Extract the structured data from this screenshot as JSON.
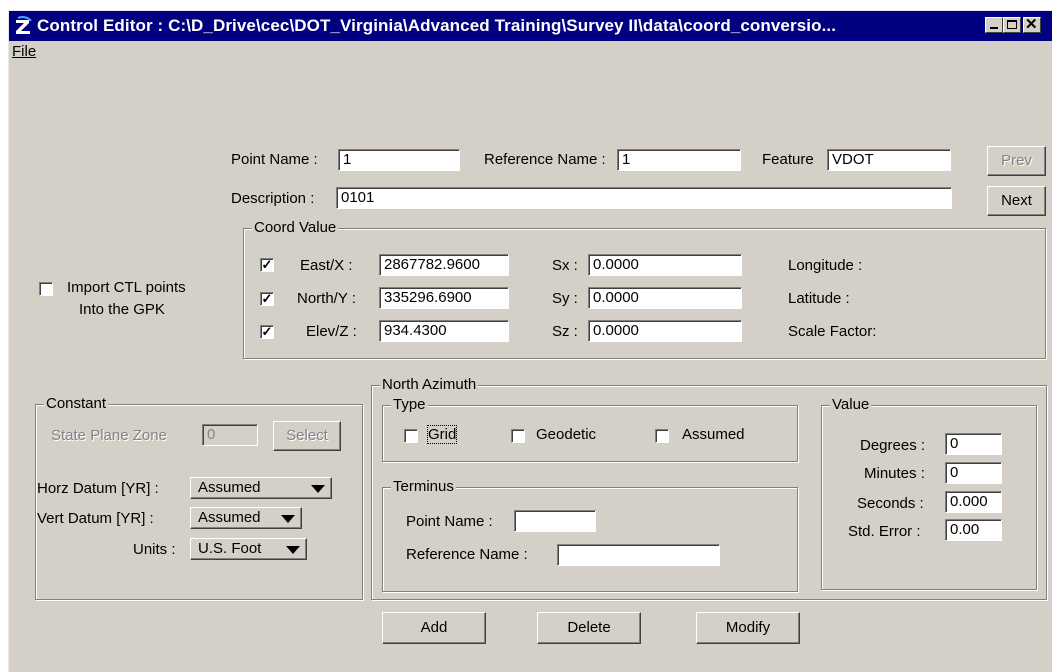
{
  "window": {
    "title": "Control Editor : C:\\D_Drive\\cec\\DOT_Virginia\\Advanced Training\\Survey II\\data\\coord_conversio...",
    "menu": {
      "file": "File"
    }
  },
  "point": {
    "point_name_label": "Point Name :",
    "point_name": "1",
    "reference_name_label": "Reference Name :",
    "reference_name": "1",
    "feature_label": "Feature",
    "feature": "VDOT",
    "description_label": "Description :",
    "description": "0101",
    "prev_label": "Prev",
    "next_label": "Next"
  },
  "import": {
    "label_line1": "Import CTL points",
    "label_line2": "Into the GPK",
    "checked": false
  },
  "coord": {
    "legend": "Coord Value",
    "rows": [
      {
        "label": "East/X :",
        "value": "2867782.9600",
        "sigma_label": "Sx :",
        "sigma": "0.0000",
        "info": "Longitude :",
        "checked": true
      },
      {
        "label": "North/Y :",
        "value": "335296.6900",
        "sigma_label": "Sy :",
        "sigma": "0.0000",
        "info": "Latitude :",
        "checked": true
      },
      {
        "label": "Elev/Z :",
        "value": "934.4300",
        "sigma_label": "Sz :",
        "sigma": "0.0000",
        "info": "Scale Factor:",
        "checked": true
      }
    ]
  },
  "constant": {
    "legend": "Constant",
    "spz_label": "State Plane Zone",
    "spz_value": "0",
    "select_label": "Select",
    "horz_label": "Horz Datum [YR] :",
    "horz_value": "Assumed",
    "vert_label": "Vert Datum [YR] :",
    "vert_value": "Assumed",
    "units_label": "Units :",
    "units_value": "U.S. Foot"
  },
  "azimuth": {
    "legend": "North Azimuth",
    "type_legend": "Type",
    "grid": "Grid",
    "geodetic": "Geodetic",
    "assumed": "Assumed",
    "terminus_legend": "Terminus",
    "t_point_label": "Point Name :",
    "t_point": "",
    "t_ref_label": "Reference Name :",
    "t_ref": "",
    "value_legend": "Value",
    "degrees_label": "Degrees :",
    "degrees": "0",
    "minutes_label": "Minutes :",
    "minutes": "0",
    "seconds_label": "Seconds :",
    "seconds": "0.000",
    "stderr_label": "Std. Error :",
    "stderr": "0.00"
  },
  "actions": {
    "add": "Add",
    "delete": "Delete",
    "modify": "Modify"
  }
}
